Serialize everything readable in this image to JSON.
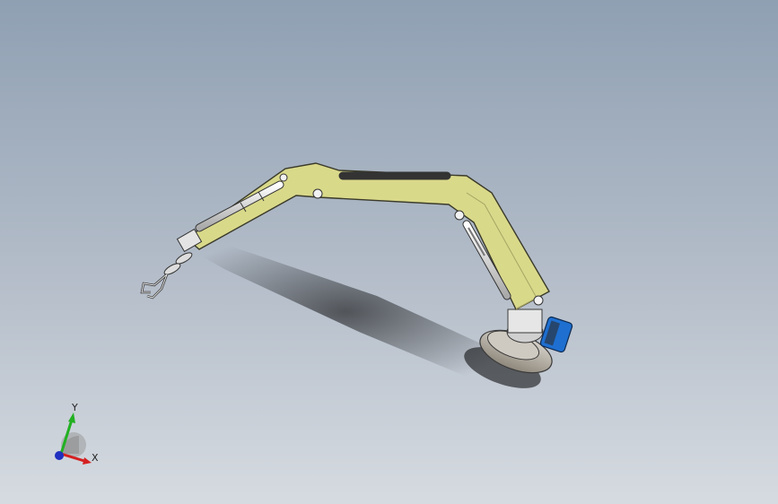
{
  "triad": {
    "x_label": "X",
    "y_label": "Y"
  },
  "colors": {
    "arm_body": "#d9d98a",
    "arm_outline": "#3a3a2a",
    "cylinder": "#e8e8e8",
    "base": "#b8b2a6",
    "motor": "#1e6fd0",
    "x_axis": "#d42020",
    "y_axis": "#22b022",
    "z_axis": "#2030c0"
  }
}
